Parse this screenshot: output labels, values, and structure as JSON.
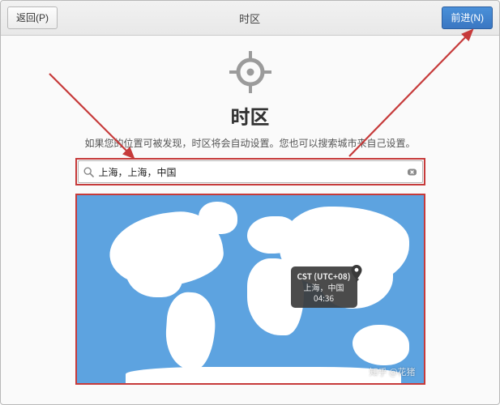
{
  "header": {
    "back_label": "返回(P)",
    "title": "时区",
    "forward_label": "前进(N)"
  },
  "main": {
    "heading": "时区",
    "hint": "如果您的位置可被发现，时区将会自动设置。您也可以搜索城市来自己设置。"
  },
  "search": {
    "icon": "search-icon",
    "value": "上海，上海，中国",
    "placeholder": "",
    "clear_icon": "clear-icon"
  },
  "location": {
    "pin_icon": "location-pin-icon",
    "tooltip_tz": "CST (UTC+08)",
    "tooltip_city": "上海，中国",
    "tooltip_time": "04:36"
  },
  "watermark": "知乎 @花猪",
  "colors": {
    "ocean": "#5da3e0",
    "land": "#ffffff",
    "primary_button": "#4a90d9",
    "annotation": "#c63a3a"
  }
}
